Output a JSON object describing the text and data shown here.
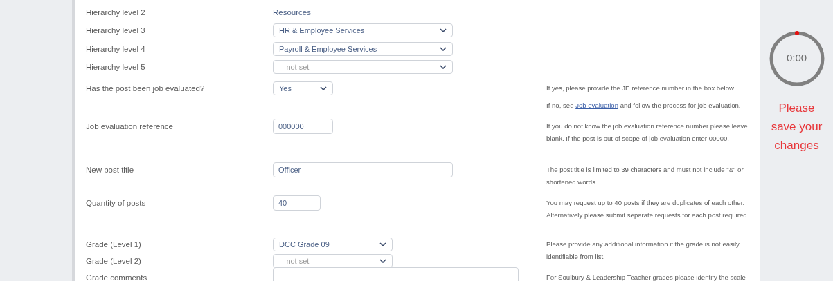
{
  "fields": [
    {
      "label": "Hierarchy level 2",
      "kind": "text",
      "value": "Resources"
    },
    {
      "label": "Hierarchy level 3",
      "kind": "select",
      "value": "HR & Employee Services"
    },
    {
      "label": "Hierarchy level 4",
      "kind": "select",
      "value": "Payroll & Employee Services"
    },
    {
      "label": "Hierarchy level 5",
      "kind": "select",
      "placeholder": "-- not set --"
    },
    {
      "label": "Has the post been job evaluated?",
      "kind": "select",
      "value": "Yes",
      "help": [
        {
          "text": "If yes, please provide the JE reference number in the box below."
        },
        {
          "text": "If no, see ",
          "link": "Job evaluation",
          "after": " and follow the process for job evaluation."
        }
      ]
    },
    {
      "label": "Job evaluation reference",
      "kind": "input",
      "value": "000000",
      "help": [
        {
          "text": "If you do not know the job evaluation reference number please leave blank. If the post is out of scope of job evaluation enter 00000."
        }
      ]
    },
    {
      "label": "New post title",
      "kind": "input",
      "value": "Officer",
      "help": [
        {
          "text": "The post title is limited to 39 characters and must not include \"&\" or shortened words."
        }
      ]
    },
    {
      "label": "Quantity of posts",
      "kind": "input",
      "value": "40",
      "help": [
        {
          "text": "You may request up to 40 posts if they are duplicates of each other. Alternatively please submit separate requests for each post required."
        }
      ]
    },
    {
      "label": "Grade (Level 1)",
      "kind": "select",
      "value": "DCC Grade 09",
      "help": [
        {
          "text": "Please provide any additional information if the grade is not easily identifiable from list."
        }
      ]
    },
    {
      "label": "Grade (Level 2)",
      "kind": "select",
      "placeholder": "-- not set --"
    },
    {
      "label": "Grade comments",
      "kind": "textarea",
      "help": [
        {
          "text": "For Soulbury & Leadership Teacher grades please identify the scale"
        }
      ]
    }
  ],
  "timer": {
    "time": "0:00",
    "message": "Please save your changes"
  }
}
